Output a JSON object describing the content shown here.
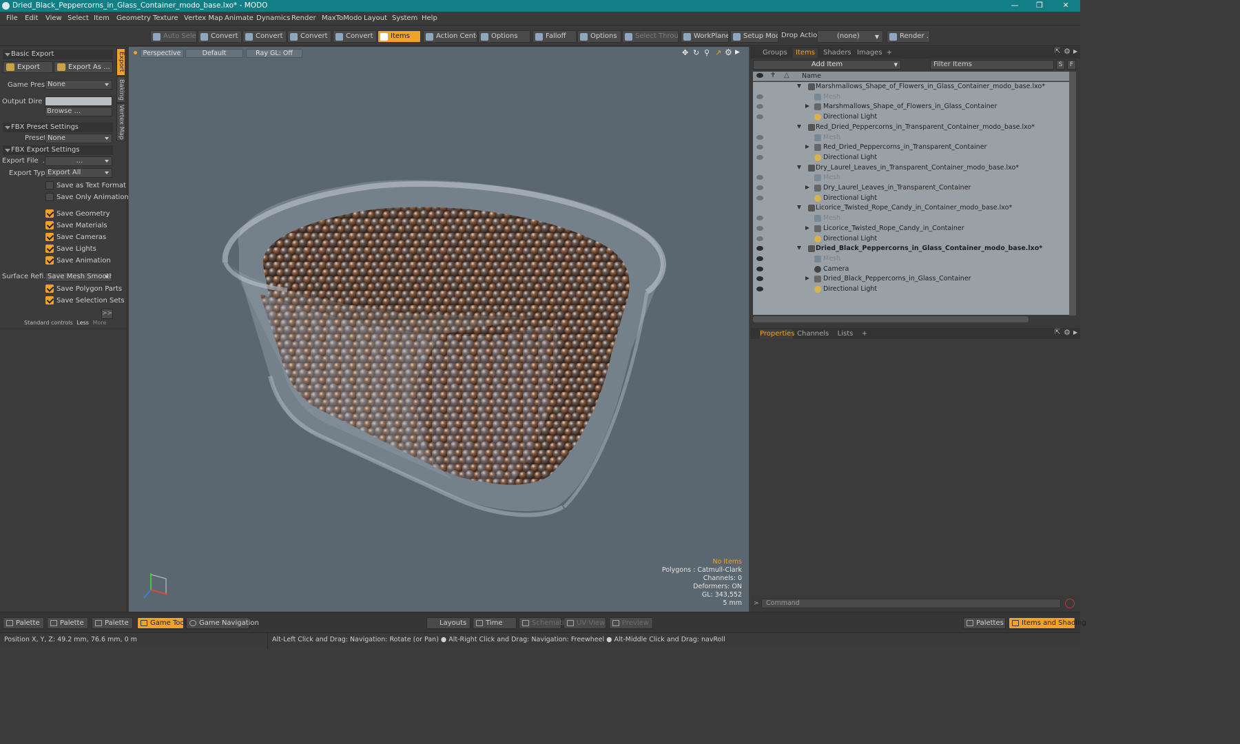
{
  "window": {
    "title": "Dried_Black_Peppercorns_in_Glass_Container_modo_base.lxo* - MODO"
  },
  "menu": [
    "File",
    "Edit",
    "View",
    "Select",
    "Item",
    "Geometry",
    "Texture",
    "Vertex Map",
    "Animate",
    "Dynamics",
    "Render",
    "MaxToModo",
    "Layout",
    "System",
    "Help"
  ],
  "toolbar": {
    "auto_select": "Auto Select",
    "convert1": "Convert",
    "convert2": "Convert",
    "convert3": "Convert",
    "convert4": "Convert",
    "items": "Items",
    "action_center": "Action Center",
    "options1": "Options",
    "falloff": "Falloff",
    "options2": "Options",
    "select_through": "Select Through",
    "workplane": "WorkPlane",
    "setup_mode": "Setup Mode",
    "drop_action_label": "Drop Action",
    "drop_action_value": "(none)",
    "render": "Render ..."
  },
  "left_panel": {
    "basic_export": "Basic Export",
    "export_btn": "Export",
    "export_as_btn": "Export As ...",
    "game_preset_label": "Game Preset",
    "game_preset_value": "None",
    "output_dir_label": "Output Dire ...",
    "browse": "Browse ...",
    "fbx_preset_settings": "FBX Preset Settings",
    "preset_label": "Preset",
    "preset_value": "None",
    "fbx_export_settings": "FBX Export Settings",
    "export_file_label": "Export File",
    "export_file_dots": "...",
    "export_file_value": "...",
    "export_type_label": "Export Type",
    "export_type_value": "Export All",
    "save_text_format": "Save as Text Format",
    "save_only_animation": "Save Only Animation",
    "save_geometry": "Save Geometry",
    "save_materials": "Save Materials",
    "save_cameras": "Save Cameras",
    "save_lights": "Save Lights",
    "save_animation": "Save Animation",
    "surface_refi_label": "Surface Refi...",
    "surface_refi_value": "Save Mesh Smooth...",
    "save_polygon_parts": "Save Polygon Parts",
    "save_selection_sets": "Save Selection Sets",
    "more_btn": ">>",
    "standard_controls": "Standard controls",
    "less": "Less",
    "more": "More",
    "side_tabs": [
      "Export",
      "Baking",
      "Vertex Map"
    ]
  },
  "viewport": {
    "perspective": "Perspective",
    "default": "Default",
    "raygl": "Ray GL: Off",
    "stats": [
      "No Items",
      "Polygons : Catmull-Clark",
      "Channels: 0",
      "Deformers: ON",
      "GL: 343,552",
      "5 mm"
    ]
  },
  "right_panel": {
    "tabs": [
      "Groups",
      "Items",
      "Shaders",
      "Images",
      "+"
    ],
    "add_item": "Add Item",
    "filter_items": "Filter Items",
    "s_btn": "S",
    "f_btn": "F",
    "name_col": "Name",
    "rows": [
      {
        "label": "Marshmallows_Shape_of_Flowers_in_Glass_Container_modo_base.lxo*"
      },
      {
        "label": "Mesh"
      },
      {
        "label": "Marshmallows_Shape_of_Flowers_in_Glass_Container"
      },
      {
        "label": "Directional Light"
      },
      {
        "label": "Red_Dried_Peppercorns_in_Transparent_Container_modo_base.lxo*"
      },
      {
        "label": "Mesh"
      },
      {
        "label": "Red_Dried_Peppercorns_in_Transparent_Container"
      },
      {
        "label": "Directional Light"
      },
      {
        "label": "Dry_Laurel_Leaves_in_Transparent_Container_modo_base.lxo*"
      },
      {
        "label": "Mesh"
      },
      {
        "label": "Dry_Laurel_Leaves_in_Transparent_Container"
      },
      {
        "label": "Directional Light"
      },
      {
        "label": "Licorice_Twisted_Rope_Candy_in_Container_modo_base.lxo*"
      },
      {
        "label": "Mesh"
      },
      {
        "label": "Licorice_Twisted_Rope_Candy_in_Container"
      },
      {
        "label": "Directional Light"
      },
      {
        "label": "Dried_Black_Peppercorns_in_Glass_Container_modo_base.lxo*"
      },
      {
        "label": "Mesh"
      },
      {
        "label": "Camera"
      },
      {
        "label": "Dried_Black_Peppercorns_in_Glass_Container"
      },
      {
        "label": "Directional Light"
      }
    ],
    "prop_tabs": [
      "Properties",
      "Channels",
      "Lists",
      "+"
    ],
    "command_placeholder": "Command"
  },
  "status_bar": {
    "palette1": "Palette",
    "palette2": "Palette",
    "palette3": "Palette",
    "game_tools": "Game Tools",
    "game_navigation": "Game Navigation",
    "layouts": "Layouts",
    "time": "Time",
    "schematic": "Schematic",
    "uv_view": "UV View",
    "preview": "Preview",
    "palettes": "Palettes",
    "items_and_shading": "Items and Shading"
  },
  "bottom_bar": {
    "position": "Position X, Y, Z:   49.2 mm, 76.6 mm, 0 m",
    "hint": "Alt-Left Click and Drag: Navigation: Rotate (or Pan) ● Alt-Right Click and Drag: Navigation: Freewheel ● Alt-Middle Click and Drag: navRoll"
  }
}
